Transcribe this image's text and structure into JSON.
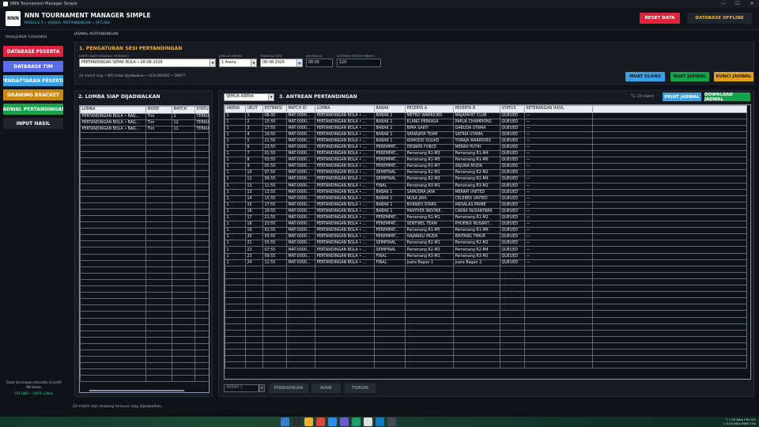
{
  "window": {
    "title": "NNN Tournament Manager Simple",
    "controls": [
      "—",
      "☐",
      "✕"
    ]
  },
  "header": {
    "logo_text": "NNN",
    "title": "NNN TOURNAMENT MANAGER SIMPLE",
    "subtitle": "MODULE 5 • JADWAL PERTANDINGAN • OFFLINE",
    "reset_label": "RESET DATA",
    "db_offline_label": "DATABASE OFFLINE",
    "colors": {
      "reset": "#e0223d",
      "db_offline": "#f2b233"
    }
  },
  "sidebar": {
    "section": "MANAJEMEN TURNAMEN",
    "items": [
      {
        "label": "DATABASE PESERTA",
        "color": "#e0223d",
        "text": "#ffffff"
      },
      {
        "label": "DATABASE TIM",
        "color": "#5b6ee8",
        "text": "#ffffff"
      },
      {
        "label": "PENDAFTARAN PESERTA",
        "color": "#3aa0e6",
        "text": "#ffffff"
      },
      {
        "label": "DRAWING  BRACKET",
        "color": "#c98a12",
        "text": "#ffffff"
      },
      {
        "label": "JADWAL PERTANDINGAN",
        "color": "#16a34a",
        "text": "#ffffff"
      },
      {
        "label": "INPUT HASIL",
        "color": "#1f2630",
        "text": "#ffffff"
      }
    ],
    "note": "Data tersimpan otomatis di profil Windows.",
    "status": "OFFLINE • 100% LOKAL"
  },
  "breadcrumb": "JADWAL PERTANDINGAN",
  "settings": {
    "title": "1. PENGATURAN SESI PERTANDINGAN",
    "event_label": "EVENT DARI DRAWING TERKUNCI",
    "event_value": "PERTANDINGAN SEPAK BOLA • 08-08-2026",
    "arena_label": "JUMLAH ARENA",
    "arena_value": "1 Arena",
    "date_label": "TANGGAL SESI",
    "date_value": "08-08-2026",
    "time_label": "JAM MULAI",
    "time_value": "08:00",
    "est_label": "ESTIMASI MATCH (MENIT)",
    "est_value": "120",
    "info": "24 match siap • BYE tidak dijadwalkan • SCH-000001 • DRAFT",
    "reload_label": "MUAT ULANG",
    "create_label": "BUAT JADWAL",
    "lock_label": "KUNCI JADWAL",
    "colors": {
      "reload": "#3aa0e6",
      "create": "#16a34a",
      "lock": "#e0a21c"
    }
  },
  "lomba": {
    "title": "2. LOMBA SIAP DIJADWALKAN",
    "headers": [
      "LOMBA",
      "MODE",
      "MATCH",
      "STATUS"
    ],
    "rows": [
      [
        "PERTANDINGAN BOLA • BAG...",
        "Tim",
        "1",
        "TERKUNCI"
      ],
      [
        "PERTANDINGAN BOLA • BAG...",
        "Tim",
        "12",
        "TERKUNCI"
      ],
      [
        "PERTANDINGAN BOLA • BAG...",
        "Tim",
        "11",
        "TERKUNCI"
      ]
    ]
  },
  "queue": {
    "title": "3. ANTREAN PERTANDINGAN",
    "filter": "SEMUA ARENA",
    "count": "T1: 24 match",
    "print_label": "PRINT JADWAL",
    "download_label": "DOWNLOAD JADWAL",
    "headers": [
      "ARENA",
      "URUT",
      "ESTIMASI",
      "MATCH ID",
      "LOMBA",
      "BABAK",
      "PESERTA A",
      "PESERTA B",
      "STATUS",
      "KETERANGAN HASIL"
    ],
    "rows": [
      [
        "1",
        "1",
        "08:00",
        "MAT-0000...",
        "PERTANDINGAN BOLA • ...",
        "BABAK 1",
        "METRO WARRIORS",
        "MAJAPAHIT CLUB",
        "QUEUED",
        "—"
      ],
      [
        "1",
        "2",
        "15:55",
        "MAT-0000...",
        "PERTANDINGAN BOLA • ...",
        "BABAK 1",
        "ELANG PERKASA",
        "PAPUA CHAMPIONS",
        "QUEUED",
        "—"
      ],
      [
        "1",
        "3",
        "17:55",
        "MAT-0000...",
        "PERTANDINGAN BOLA • ...",
        "BABAK 1",
        "BIMA SAKTI",
        "GARUDA UTAMA",
        "QUEUED",
        "—"
      ],
      [
        "1",
        "4",
        "19:55",
        "MAT-0000...",
        "PERTANDINGAN BOLA • ...",
        "BABAK 1",
        "SRIWIJAYA TEAM",
        "SATRIA UTAMA",
        "QUEUED",
        "—"
      ],
      [
        "1",
        "5",
        "21:55",
        "MAT-0000...",
        "PERTANDINGAN BOLA • ...",
        "BABAK 1",
        "KOMODO SQUAD",
        "TORAJA WARRIORS",
        "QUEUED",
        "—"
      ],
      [
        "1",
        "6",
        "23:55",
        "MAT-0000...",
        "PERTANDINGAN BOLA • ...",
        "PEREMPAT...",
        "DEWATA FORCE",
        "MERAH PUTIH",
        "QUEUED",
        "—"
      ],
      [
        "1",
        "7",
        "01:55",
        "MAT-0000...",
        "PERTANDINGAN BOLA • ...",
        "PEREMPAT...",
        "Pemenang R1-M3",
        "Pemenang R1-M4",
        "QUEUED",
        "—"
      ],
      [
        "1",
        "8",
        "03:55",
        "MAT-0000...",
        "PERTANDINGAN BOLA • ...",
        "PEREMPAT...",
        "Pemenang R1-M5",
        "Pemenang R1-M6",
        "QUEUED",
        "—"
      ],
      [
        "1",
        "9",
        "05:55",
        "MAT-0000...",
        "PERTANDINGAN BOLA • ...",
        "PEREMPAT...",
        "Pemenang R1-M7",
        "ARJUNA MUDA",
        "QUEUED",
        "—"
      ],
      [
        "1",
        "10",
        "07:55",
        "MAT-0000...",
        "PERTANDINGAN BOLA • ...",
        "SEMIFINAL",
        "Pemenang R2-M1",
        "Pemenang R2-M2",
        "QUEUED",
        "—"
      ],
      [
        "1",
        "11",
        "09:55",
        "MAT-0000...",
        "PERTANDINGAN BOLA • ...",
        "SEMIFINAL",
        "Pemenang R2-M3",
        "Pemenang R2-M4",
        "QUEUED",
        "—"
      ],
      [
        "1",
        "12",
        "11:55",
        "MAT-0000...",
        "PERTANDINGAN BOLA • ...",
        "FINAL",
        "Pemenang R3-M1",
        "Pemenang R3-M2",
        "QUEUED",
        "—"
      ],
      [
        "1",
        "13",
        "13:55",
        "MAT-0000...",
        "PERTANDINGAN BOLA • ...",
        "BABAK 1",
        "SAMUDRA JAYA",
        "MERAPI UNITED",
        "QUEUED",
        "—"
      ],
      [
        "1",
        "14",
        "15:55",
        "MAT-0000...",
        "PERTANDINGAN BOLA • ...",
        "BABAK 1",
        "NUSA JAYA",
        "CELEBES UNITED",
        "QUEUED",
        "—"
      ],
      [
        "1",
        "15",
        "17:55",
        "MAT-0000...",
        "PERTANDINGAN BOLA • ...",
        "BABAK 1",
        "BORNEO STARS",
        "ANDALAS PRIME",
        "QUEUED",
        "—"
      ],
      [
        "1",
        "16",
        "19:55",
        "MAT-0000...",
        "PERTANDINGAN BOLA • ...",
        "BABAK 1",
        "PANTHER INDONE...",
        "CAKRA NUSANTARA",
        "QUEUED",
        "—"
      ],
      [
        "1",
        "17",
        "21:55",
        "MAT-0000...",
        "PERTANDINGAN BOLA • ...",
        "PEREMPAT...",
        "Pemenang R1-M1",
        "Pemenang R1-M2",
        "QUEUED",
        "—"
      ],
      [
        "1",
        "18",
        "23:55",
        "MAT-0000...",
        "PERTANDINGAN BOLA • ...",
        "PEREMPAT...",
        "SENTINEL TEAM",
        "PHOENIX NUSANT...",
        "QUEUED",
        "—"
      ],
      [
        "1",
        "19",
        "01:55",
        "MAT-0000...",
        "PERTANDINGAN BOLA • ...",
        "PEREMPAT...",
        "Pemenang R1-M5",
        "Pemenang R1-M6",
        "QUEUED",
        "—"
      ],
      [
        "1",
        "20",
        "03:55",
        "MAT-0000...",
        "PERTANDINGAN BOLA • ...",
        "PEREMPAT...",
        "HAJAWALI MUDA",
        "BINTANG TIMUR",
        "QUEUED",
        "—"
      ],
      [
        "1",
        "21",
        "05:55",
        "MAT-0000...",
        "PERTANDINGAN BOLA • ...",
        "SEMIFINAL",
        "Pemenang R2-M1",
        "Pemenang R2-M2",
        "QUEUED",
        "—"
      ],
      [
        "1",
        "22",
        "07:55",
        "MAT-0000...",
        "PERTANDINGAN BOLA • ...",
        "SEMIFINAL",
        "Pemenang R2-M3",
        "Pemenang R2-M4",
        "QUEUED",
        "—"
      ],
      [
        "1",
        "23",
        "09:55",
        "MAT-0000...",
        "PERTANDINGAN BOLA • ...",
        "FINAL",
        "Pemenang R3-M1",
        "Pemenang R3-M2",
        "QUEUED",
        "—"
      ],
      [
        "1",
        "24",
        "11:55",
        "MAT-0000...",
        "PERTANDINGAN BOLA • ...",
        "FINAL",
        "Juara Bagan 1",
        "Juara Bagan 2",
        "QUEUED",
        "—"
      ]
    ],
    "move_arena": "ARENA 1",
    "move_label": "PINDAHKAN",
    "up_label": "NAIK",
    "down_label": "TURUN"
  },
  "statusbar": "24 match dari drawing terkunci siap dijadwalkan.",
  "taskbar": {
    "line1": "↑ 1.55 KB/s   CPU 5%",
    "line2": "↓ 0.04 KB/s   RAM 21%"
  }
}
